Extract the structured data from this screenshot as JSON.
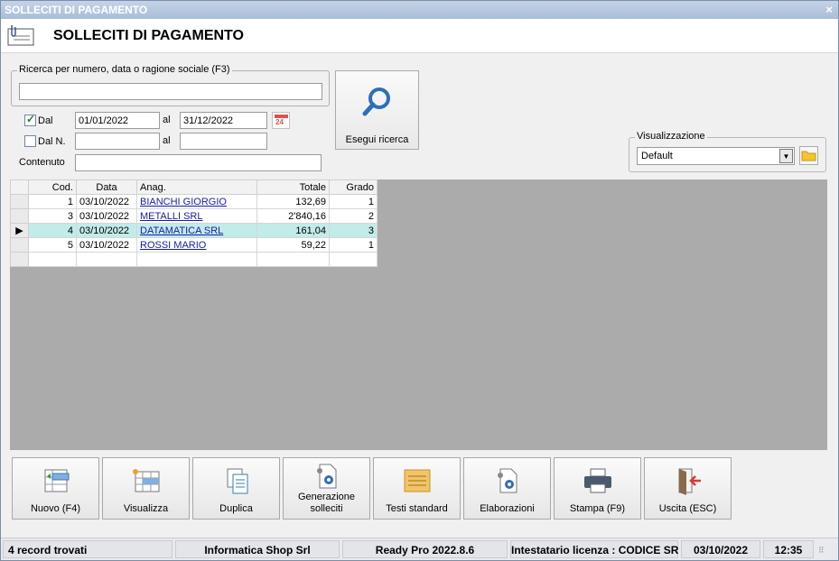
{
  "window": {
    "title": "SOLLECITI DI PAGAMENTO",
    "close_symbol": "×"
  },
  "header": {
    "title": "SOLLECITI DI PAGAMENTO",
    "icon": "clipped-document-icon"
  },
  "search": {
    "group_label": "Ricerca per numero, data o ragione sociale (F3)",
    "value": "",
    "placeholder": ""
  },
  "filters": {
    "dal_label": "Dal",
    "dal_checked": true,
    "date_from": "01/01/2022",
    "al_label": "al",
    "date_to": "31/12/2022",
    "dal_n_label": "Dal N.",
    "dal_n_checked": false,
    "num_from": "",
    "al_label_2": "al",
    "num_to": "",
    "contenuto_label": "Contenuto",
    "contenuto_value": "",
    "calendar_day": "24"
  },
  "search_button": {
    "label": "Esegui ricerca",
    "icon": "magnifier-icon"
  },
  "visualizzazione": {
    "label": "Visualizzazione",
    "selected": "Default"
  },
  "grid": {
    "columns": [
      "Cod.",
      "Data",
      "Anag.",
      "Totale",
      "Grado"
    ],
    "rows": [
      {
        "cod": "1",
        "data": "03/10/2022",
        "anag": "BIANCHI GIORGIO",
        "totale": "132,69",
        "grado": "1"
      },
      {
        "cod": "3",
        "data": "03/10/2022",
        "anag": "METALLI SRL",
        "totale": "2'840,16",
        "grado": "2"
      },
      {
        "cod": "4",
        "data": "03/10/2022",
        "anag": "DATAMATICA SRL",
        "totale": "161,04",
        "grado": "3"
      },
      {
        "cod": "5",
        "data": "03/10/2022",
        "anag": "ROSSI MARIO",
        "totale": "59,22",
        "grado": "1"
      }
    ],
    "selected_row": 2,
    "selected_color": "#c1ece9"
  },
  "toolbar": [
    {
      "label": "Nuovo (F4)",
      "icon": "new-record-icon"
    },
    {
      "label": "Visualizza",
      "icon": "grid-view-icon"
    },
    {
      "label": "Duplica",
      "icon": "duplicate-icon"
    },
    {
      "label": "Generazione solleciti",
      "icon": "document-gear-icon"
    },
    {
      "label": "Testi standard",
      "icon": "notes-icon"
    },
    {
      "label": "Elaborazioni",
      "icon": "document-gear-icon"
    },
    {
      "label": "Stampa (F9)",
      "icon": "printer-icon"
    },
    {
      "label": "Uscita (ESC)",
      "icon": "exit-door-icon"
    }
  ],
  "status": {
    "records": "4 record trovati",
    "company": "Informatica Shop Srl",
    "version": "Ready Pro 2022.8.6",
    "license": "Intestatario licenza : CODICE SR",
    "date": "03/10/2022",
    "time": "12:35"
  }
}
